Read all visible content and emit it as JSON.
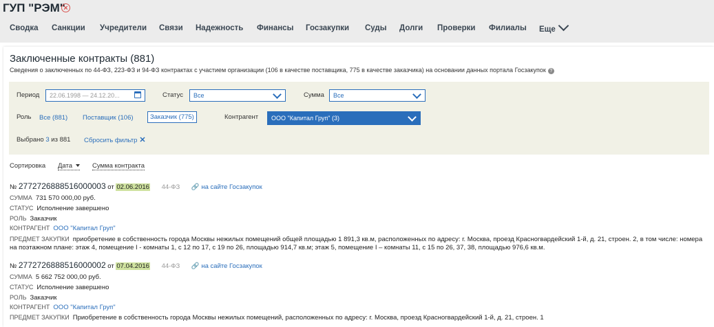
{
  "header": {
    "company": "ГУП \"РЭМ\"",
    "close_glyph": "×",
    "nav": [
      {
        "label": "Сводка"
      },
      {
        "label": "Санкции"
      },
      {
        "label": "Учредители"
      },
      {
        "label": "Связи"
      },
      {
        "label": "Надежность"
      },
      {
        "label": "Финансы"
      },
      {
        "label": "Госзакупки"
      },
      {
        "label": "Суды"
      },
      {
        "label": "Долги"
      },
      {
        "label": "Проверки"
      },
      {
        "label": "Филиалы"
      },
      {
        "label": "Еще"
      }
    ]
  },
  "main": {
    "title": "Заключенные контракты (881)",
    "subtitle": "Сведения о заключенных по 44-ФЗ, 223-ФЗ и 94-ФЗ контрактах с участием организации (106 в качестве поставщика, 775 в качестве заказчика) на основании данных портала Госзакупок",
    "help_glyph": "?"
  },
  "filters": {
    "period_label": "Период",
    "period_value": "22.06.1998 — 24.12.20...",
    "status_label": "Статус",
    "status_value": "Все",
    "sum_label": "Сумма",
    "sum_value": "Все",
    "role_label": "Роль",
    "roles": [
      {
        "label": "Все (881)"
      },
      {
        "label": "Поставщик (106)"
      },
      {
        "label": "Заказчик (775)"
      }
    ],
    "counterparty_label": "Контрагент",
    "counterparty_value": "ООО \"Капитал Груп\" (3)",
    "selected_prefix": "Выбрано",
    "selected_count": "3",
    "selected_suffix": "из 881",
    "reset_label": "Сбросить фильтр",
    "reset_glyph": "✕"
  },
  "sort": {
    "label": "Сортировка",
    "options": [
      {
        "label": "Дата"
      },
      {
        "label": "Сумма контракта"
      }
    ]
  },
  "contracts": [
    {
      "prefix": "№",
      "number": "2772726888516000003",
      "date_prefix": "от",
      "date": "02.06.2016",
      "law": "44-ФЗ",
      "link_label": "на сайте Госзакупок",
      "sum_key": "Сумма",
      "sum": "731 570 000,00 руб.",
      "status_key": "Статус",
      "status": "Исполнение завершено",
      "role_key": "Роль",
      "role": "Заказчик",
      "counterparty_key": "Контрагент",
      "counterparty": "ООО \"Капитал Груп\"",
      "subject_key": "Предмет закупки",
      "subject": "приобретение в собственность города Москвы нежилых помещений общей площадью 1 891,3 кв.м, расположенных по адресу: г. Москва, проезд Красногвардейский 1-й, д. 21, строен. 2, в том числе: номера на поэтажном плане: этаж 4, помещение I - комнаты 1, с 12 по 17, с 19 по 26, площадью 914,7 кв.м; этаж 5, помещение I – комнаты 11, с 15 по 26, 37, 38, площадью 976,6 кв.м."
    },
    {
      "prefix": "№",
      "number": "2772726888516000002",
      "date_prefix": "от",
      "date": "07.04.2016",
      "law": "44-ФЗ",
      "link_label": "на сайте Госзакупок",
      "sum_key": "Сумма",
      "sum": "5 662 752 000,00 руб.",
      "status_key": "Статус",
      "status": "Исполнение завершено",
      "role_key": "Роль",
      "role": "Заказчик",
      "counterparty_key": "Контрагент",
      "counterparty": "ООО \"Капитал Груп\"",
      "subject_key": "Предмет закупки",
      "subject": "Приобретение в собственность города Москвы нежилых помещений, расположенных по адресу: г. Москва, проезд Красногвардейский 1-й, д. 21, строен. 1"
    }
  ],
  "colors": {
    "accent": "#2a6ebb",
    "date_highlight": "#cfe2a0",
    "filter_bg": "#f1f1e6",
    "close": "#d9534f"
  },
  "icons": {
    "close": "close-circle-icon",
    "nav_more": "chevron-down-icon",
    "calendar": "calendar-icon",
    "link": "link-icon",
    "help": "help-icon",
    "sort": "sort-arrow-icon"
  }
}
